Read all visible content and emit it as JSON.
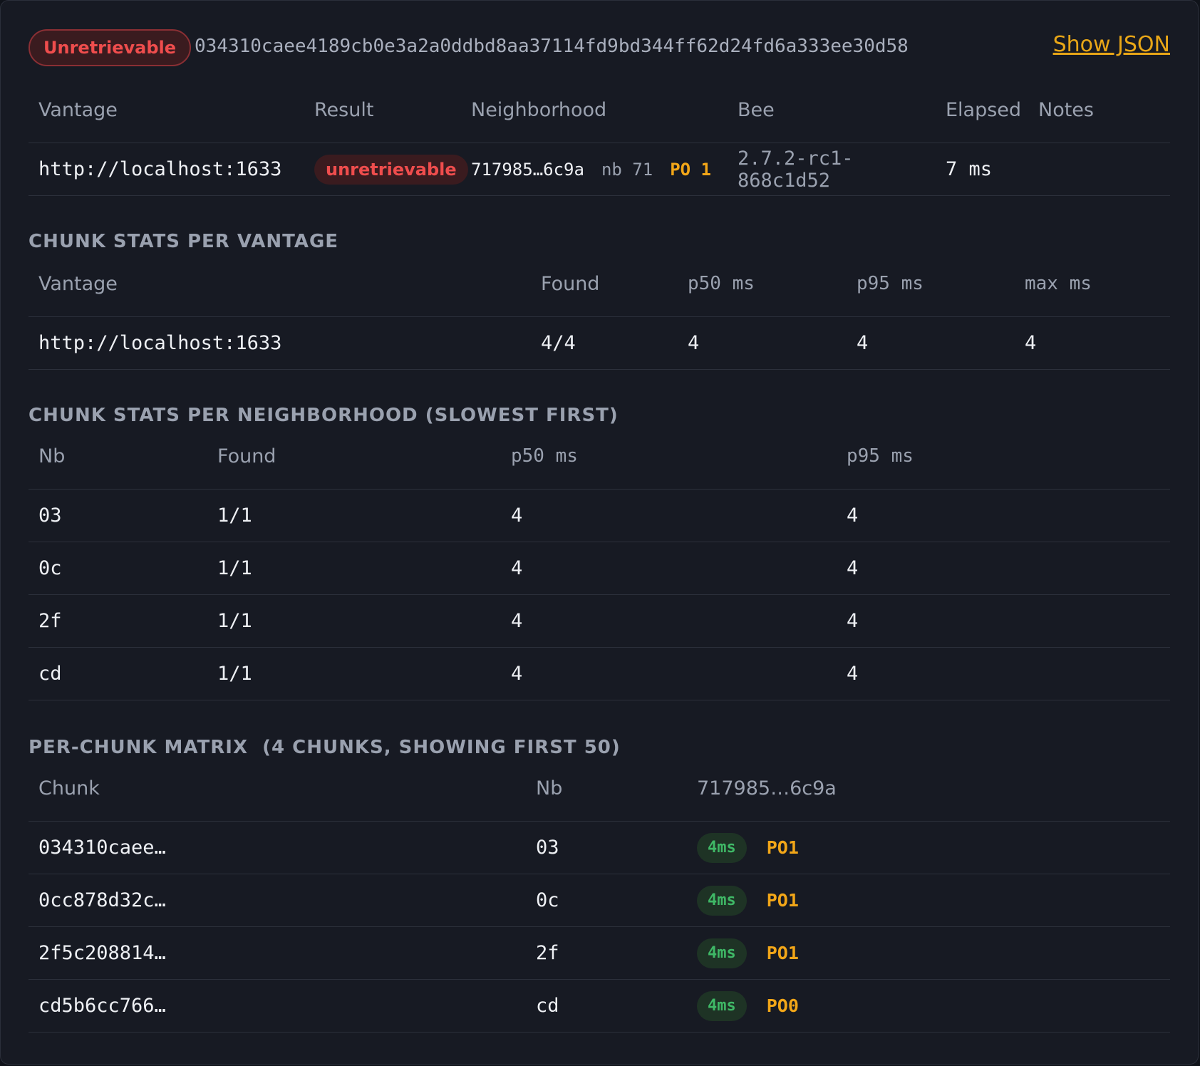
{
  "header": {
    "status_badge": "Unretrievable",
    "content_id": "034310caee4189cb0e3a2a0ddbd8aa37114fd9bd344ff62d24fd6a333ee30d58",
    "show_json": "Show JSON"
  },
  "results": {
    "columns": [
      "Vantage",
      "Result",
      "Neighborhood",
      "Bee",
      "Elapsed",
      "Notes"
    ],
    "rows": [
      {
        "vantage": "http://localhost:1633",
        "result": "unretrievable",
        "neighborhood": "717985…6c9a",
        "nb": "nb 71",
        "po": "PO 1",
        "bee": "2.7.2-rc1-868c1d52",
        "elapsed": "7 ms",
        "notes": ""
      }
    ]
  },
  "vantage_stats": {
    "title": "CHUNK STATS PER VANTAGE",
    "columns": [
      "Vantage",
      "Found",
      "p50 ms",
      "p95 ms",
      "max ms"
    ],
    "rows": [
      {
        "vantage": "http://localhost:1633",
        "found": "4/4",
        "p50": "4",
        "p95": "4",
        "max": "4"
      }
    ]
  },
  "neighborhood_stats": {
    "title": "CHUNK STATS PER NEIGHBORHOOD (SLOWEST FIRST)",
    "columns": [
      "Nb",
      "Found",
      "p50 ms",
      "p95 ms"
    ],
    "rows": [
      {
        "nb": "03",
        "found": "1/1",
        "p50": "4",
        "p95": "4"
      },
      {
        "nb": "0c",
        "found": "1/1",
        "p50": "4",
        "p95": "4"
      },
      {
        "nb": "2f",
        "found": "1/1",
        "p50": "4",
        "p95": "4"
      },
      {
        "nb": "cd",
        "found": "1/1",
        "p50": "4",
        "p95": "4"
      }
    ]
  },
  "matrix": {
    "title": "PER-CHUNK MATRIX",
    "subtitle": "(4 CHUNKS, SHOWING FIRST 50)",
    "columns": [
      "Chunk",
      "Nb",
      "717985…6c9a"
    ],
    "rows": [
      {
        "chunk": "034310caee…",
        "nb": "03",
        "ms": "4ms",
        "po": "PO1"
      },
      {
        "chunk": "0cc878d32c…",
        "nb": "0c",
        "ms": "4ms",
        "po": "PO1"
      },
      {
        "chunk": "2f5c208814…",
        "nb": "2f",
        "ms": "4ms",
        "po": "PO1"
      },
      {
        "chunk": "cd5b6cc766…",
        "nb": "cd",
        "ms": "4ms",
        "po": "PO0"
      }
    ]
  },
  "colors": {
    "background": "#171a23",
    "error": "#ef4d4d",
    "warning": "#f2a618",
    "success": "#3fb866",
    "muted": "#9aa1af"
  }
}
